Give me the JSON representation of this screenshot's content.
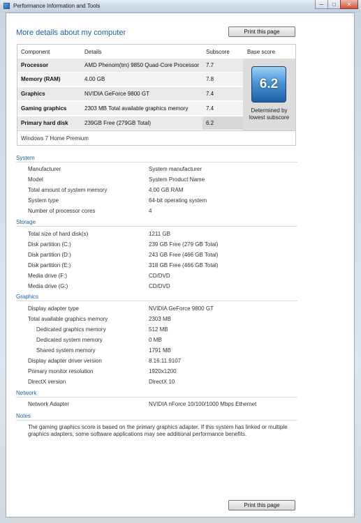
{
  "window": {
    "title": "Performance Information and Tools",
    "minimize": "─",
    "maximize": "□",
    "close": "✕"
  },
  "page": {
    "title": "More details about my computer",
    "print_label": "Print this page"
  },
  "score_table": {
    "headers": [
      "Component",
      "Details",
      "Subscore",
      "Base score"
    ],
    "rows": [
      {
        "component": "Processor",
        "details": "AMD Phenom(tm) 9850 Quad-Core Processor",
        "subscore": "7.7"
      },
      {
        "component": "Memory (RAM)",
        "details": "4.00 GB",
        "subscore": "7.8"
      },
      {
        "component": "Graphics",
        "details": "NVIDIA GeForce 9800 GT",
        "subscore": "7.4"
      },
      {
        "component": "Gaming graphics",
        "details": "2303 MB Total available graphics memory",
        "subscore": "7.4"
      },
      {
        "component": "Primary hard disk",
        "details": "239GB Free (279GB Total)",
        "subscore": "6.2"
      }
    ],
    "base_score": "6.2",
    "base_caption": "Determined by lowest subscore",
    "edition": "Windows 7 Home Premium"
  },
  "system": {
    "title": "System",
    "items": [
      {
        "label": "Manufacturer",
        "value": "System manufacturer"
      },
      {
        "label": "Model",
        "value": "System Product Name"
      },
      {
        "label": "Total amount of system memory",
        "value": "4.00 GB RAM"
      },
      {
        "label": "System type",
        "value": "64-bit operating system"
      },
      {
        "label": "Number of processor cores",
        "value": "4"
      }
    ]
  },
  "storage": {
    "title": "Storage",
    "items": [
      {
        "label": "Total size of hard disk(s)",
        "value": "1211 GB"
      },
      {
        "label": "Disk partition (C:)",
        "value": "239 GB Free (279 GB Total)"
      },
      {
        "label": "Disk partition (D:)",
        "value": "243 GB Free (466 GB Total)"
      },
      {
        "label": "Disk partition (E:)",
        "value": "318 GB Free (466 GB Total)"
      },
      {
        "label": "Media drive (F:)",
        "value": "CD/DVD"
      },
      {
        "label": "Media drive (G:)",
        "value": "CD/DVD"
      }
    ]
  },
  "graphics": {
    "title": "Graphics",
    "items": [
      {
        "label": "Display adapter type",
        "value": "NVIDIA GeForce 9800 GT"
      },
      {
        "label": "Total available graphics memory",
        "value": "2303 MB"
      },
      {
        "label": "Dedicated graphics memory",
        "value": "512 MB"
      },
      {
        "label": "Dedicated system memory",
        "value": "0 MB"
      },
      {
        "label": "Shared system memory",
        "value": "1791 MB"
      },
      {
        "label": "Display adapter driver version",
        "value": "8.16.11.9107"
      },
      {
        "label": "Primary monitor resolution",
        "value": "1920x1200"
      },
      {
        "label": "DirectX version",
        "value": "DirectX 10"
      }
    ]
  },
  "network": {
    "title": "Network",
    "items": [
      {
        "label": "Network Adapter",
        "value": "NVIDIA nForce 10/100/1000 Mbps Ethernet"
      }
    ]
  },
  "notes": {
    "title": "Notes",
    "text": "The gaming graphics score is based on the primary graphics adapter. If this system has linked or multiple graphics adapters, some software applications may see additional performance benefits."
  }
}
